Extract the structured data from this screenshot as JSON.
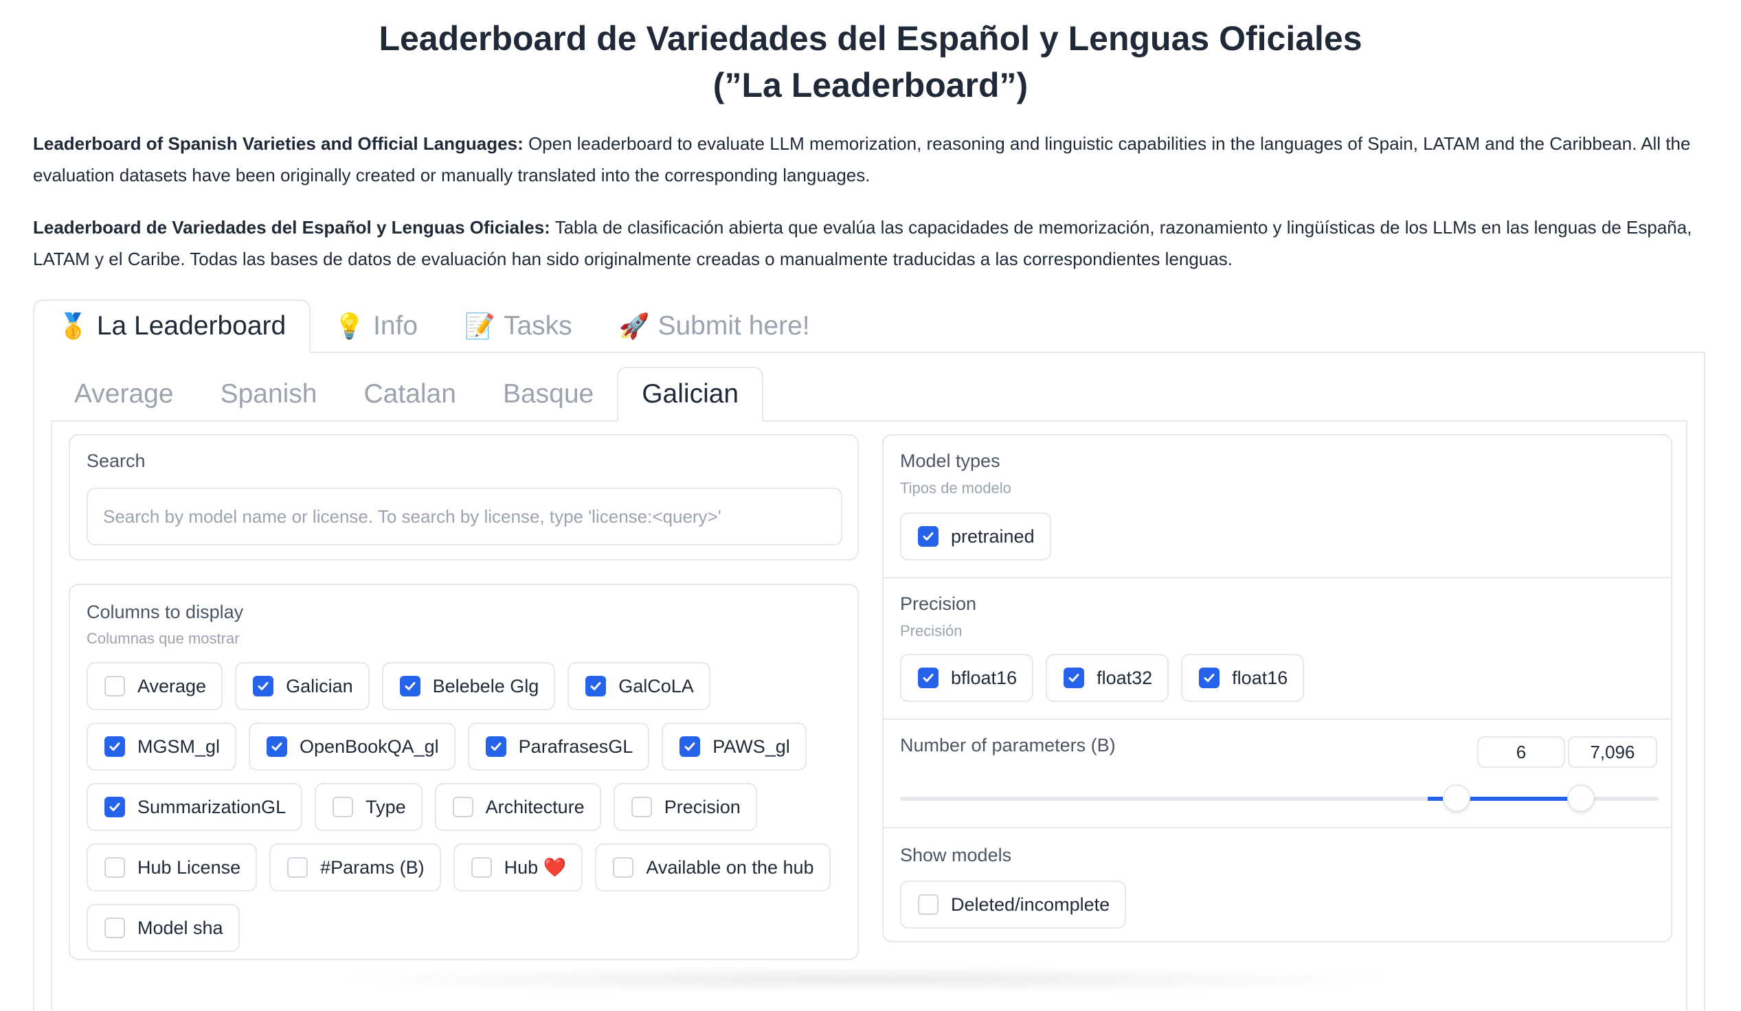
{
  "header": {
    "title_line1": "Leaderboard de Variedades del Español y Lenguas Oficiales",
    "title_line2": "(”La Leaderboard”)"
  },
  "intro": {
    "en_bold": "Leaderboard of Spanish Varieties and Official Languages:",
    "en_text": " Open leaderboard to evaluate LLM memorization, reasoning and linguistic capabilities in the languages of Spain, LATAM and the Caribbean. All the evaluation datasets have been originally created or manually translated into the corresponding languages.",
    "es_bold": "Leaderboard de Variedades del Español y Lenguas Oficiales:",
    "es_text": " Tabla de clasificación abierta que evalúa las capacidades de memorización, razonamiento y lingüísticas de los LLMs en las lenguas de España, LATAM y el Caribe. Todas las bases de datos de evaluación han sido originalmente creadas o manualmente traducidas a las correspondientes lenguas."
  },
  "main_tabs": [
    {
      "emoji": "🥇",
      "label": "La Leaderboard",
      "active": true
    },
    {
      "emoji": "💡",
      "label": "Info",
      "active": false
    },
    {
      "emoji": "📝",
      "label": "Tasks",
      "active": false
    },
    {
      "emoji": "🚀",
      "label": "Submit here!",
      "active": false
    }
  ],
  "sub_tabs": [
    "Average",
    "Spanish",
    "Catalan",
    "Basque",
    "Galician"
  ],
  "active_sub_tab": "Galician",
  "search": {
    "label": "Search",
    "placeholder": "Search by model name or license. To search by license, type 'license:<query>'",
    "value": ""
  },
  "columns": {
    "label": "Columns to display",
    "sublabel": "Columnas que mostrar",
    "items": [
      {
        "label": "Average",
        "checked": false
      },
      {
        "label": "Galician",
        "checked": true
      },
      {
        "label": "Belebele Glg",
        "checked": true
      },
      {
        "label": "GalCoLA",
        "checked": true
      },
      {
        "label": "MGSM_gl",
        "checked": true
      },
      {
        "label": "OpenBookQA_gl",
        "checked": true
      },
      {
        "label": "ParafrasesGL",
        "checked": true
      },
      {
        "label": "PAWS_gl",
        "checked": true
      },
      {
        "label": "SummarizationGL",
        "checked": true
      },
      {
        "label": "Type",
        "checked": false
      },
      {
        "label": "Architecture",
        "checked": false
      },
      {
        "label": "Precision",
        "checked": false
      },
      {
        "label": "Hub License",
        "checked": false
      },
      {
        "label": "#Params (B)",
        "checked": false
      },
      {
        "label": "Hub ❤️",
        "checked": false
      },
      {
        "label": "Available on the hub",
        "checked": false
      },
      {
        "label": "Model sha",
        "checked": false
      }
    ]
  },
  "model_types": {
    "label": "Model types",
    "sublabel": "Tipos de modelo",
    "items": [
      {
        "label": "pretrained",
        "checked": true
      }
    ]
  },
  "precision": {
    "label": "Precision",
    "sublabel": "Precisión",
    "items": [
      {
        "label": "bfloat16",
        "checked": true
      },
      {
        "label": "float32",
        "checked": true
      },
      {
        "label": "float16",
        "checked": true
      }
    ]
  },
  "params": {
    "label": "Number of parameters (B)",
    "min_value": "6",
    "max_value": "7,096",
    "range_low_fraction": 0.734,
    "range_high_fraction": 0.898
  },
  "show_models": {
    "label": "Show models",
    "items": [
      {
        "label": "Deleted/incomplete",
        "checked": false
      }
    ]
  },
  "colors": {
    "accent": "#2563eb",
    "border": "#e5e7eb",
    "muted_text": "#9ca3af"
  }
}
